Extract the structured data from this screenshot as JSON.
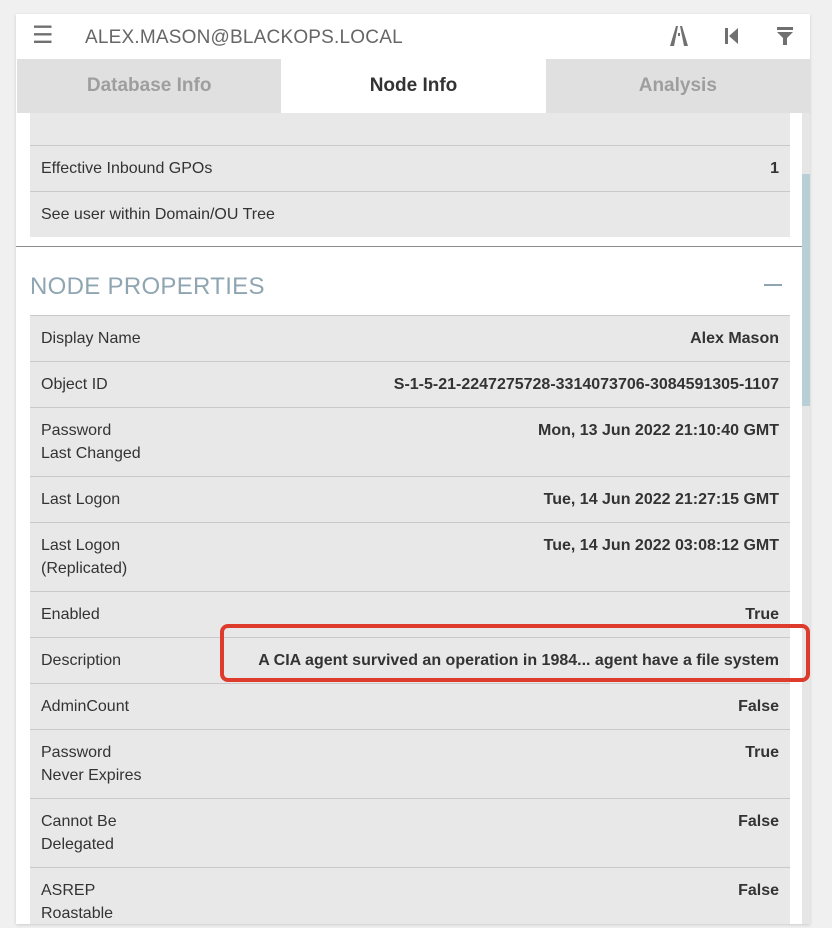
{
  "header": {
    "user": "ALEX.MASON@BLACKOPS.LOCAL",
    "icons": [
      "menu-icon",
      "pathfinding-icon",
      "back-icon",
      "filter-icon"
    ]
  },
  "tabs": [
    {
      "label": "Database Info",
      "active": false
    },
    {
      "label": "Node Info",
      "active": true
    },
    {
      "label": "Analysis",
      "active": false
    }
  ],
  "overview_rows": [
    {
      "label": "Effective Inbound GPOs",
      "value": "1"
    },
    {
      "label": "See user within Domain/OU Tree",
      "value": ""
    }
  ],
  "node_properties": {
    "title": "NODE PROPERTIES",
    "rows": [
      {
        "label": "Display Name",
        "value": "Alex Mason"
      },
      {
        "label": "Object ID",
        "value": "S-1-5-21-2247275728-3314073706-3084591305-1107"
      },
      {
        "label": "Password\nLast Changed",
        "value": "Mon, 13 Jun 2022 21:10:40 GMT"
      },
      {
        "label": "Last Logon",
        "value": "Tue, 14 Jun 2022 21:27:15 GMT"
      },
      {
        "label": "Last Logon\n(Replicated)",
        "value": "Tue, 14 Jun 2022 03:08:12 GMT"
      },
      {
        "label": "Enabled",
        "value": "True"
      },
      {
        "label": "Description",
        "value": "A CIA agent survived an operation in 1984... agent have a file system"
      },
      {
        "label": "AdminCount",
        "value": "False"
      },
      {
        "label": "Password\nNever Expires",
        "value": "True"
      },
      {
        "label": "Cannot Be\nDelegated",
        "value": "False"
      },
      {
        "label": "ASREP\nRoastable",
        "value": "False"
      }
    ]
  },
  "colors": {
    "highlight": "#dd3b2b",
    "section_title": "#8fa6b2",
    "row_background": "#e8e8e8"
  }
}
